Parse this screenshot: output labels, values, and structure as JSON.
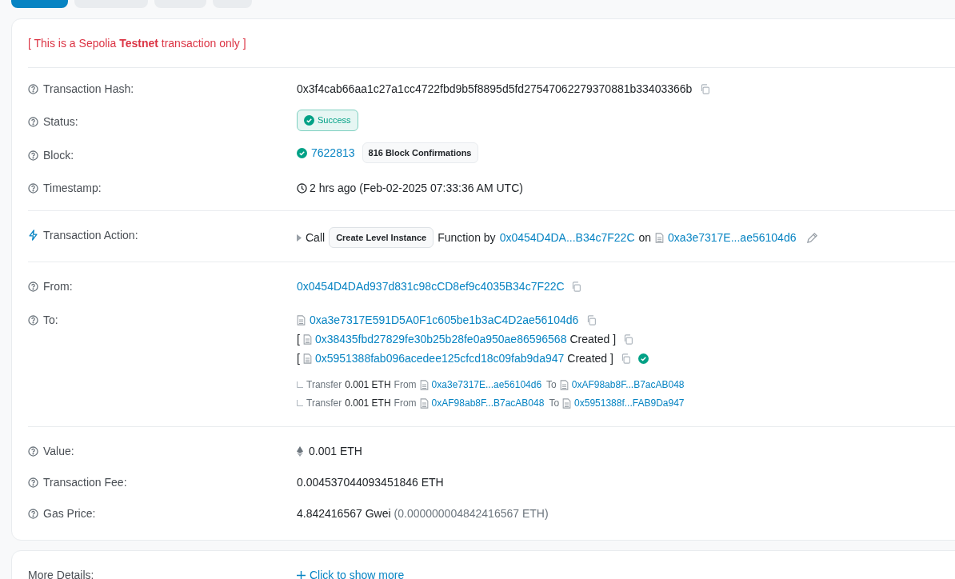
{
  "tabs": [
    {
      "selected": true
    },
    {
      "selected": false
    },
    {
      "selected": false
    },
    {
      "selected": false
    }
  ],
  "notice": "[ This is a Sepolia **Testnet** transaction only ]",
  "hash": {
    "label": "Transaction Hash:",
    "value": "0x3f4cab66aa1c27a1cc4722fbd9b5f8895d5fd27547062279370881b33403366b"
  },
  "status": {
    "label": "Status:",
    "value": "Success"
  },
  "block": {
    "label": "Block:",
    "number": "7622813",
    "confirmations": "816 Block Confirmations"
  },
  "timestamp": {
    "label": "Timestamp:",
    "value": "2 hrs ago (Feb-02-2025 07:33:36 AM UTC)"
  },
  "action": {
    "label": "Transaction Action:",
    "verb": "Call",
    "method": "Create Level Instance",
    "by_text": "Function by",
    "from": "0x0454D4DA...B34c7F22C",
    "on_text": "on",
    "contract": "0xa3e7317E...ae56104d6"
  },
  "from": {
    "label": "From:",
    "address": "0x0454D4DAd937d831c98cCD8ef9c4035B34c7F22C"
  },
  "to": {
    "label": "To:",
    "address": "0xa3e7317E591D5A0F1c605be1b3aC4D2ae56104d6",
    "created": [
      {
        "prefix": "[",
        "address": "0x38435fbd27829fe30b25b28fe0a950ae86596568",
        "suffix": "Created ]",
        "verified": false
      },
      {
        "prefix": "[",
        "address": "0x5951388fab096acedee125cfcd18c09fab9da947",
        "suffix": "Created ]",
        "verified": true
      }
    ],
    "transfers": [
      {
        "word": "Transfer",
        "amount": "0.001 ETH",
        "from_word": "From",
        "from": "0xa3e7317E...ae56104d6",
        "to_word": "To",
        "to": "0xAF98ab8F...B7acAB048"
      },
      {
        "word": "Transfer",
        "amount": "0.001 ETH",
        "from_word": "From",
        "from": "0xAF98ab8F...B7acAB048",
        "to_word": "To",
        "to": "0x5951388f...FAB9Da947"
      }
    ]
  },
  "value": {
    "label": "Value:",
    "value": "0.001 ETH"
  },
  "fee": {
    "label": "Transaction Fee:",
    "value": "0.004537044093451846 ETH"
  },
  "gas": {
    "label": "Gas Price:",
    "gwei": "4.842416567 Gwei",
    "eth": "(0.000000004842416567 ETH)"
  },
  "more": {
    "label": "More Details:",
    "link": "Click to show more"
  }
}
